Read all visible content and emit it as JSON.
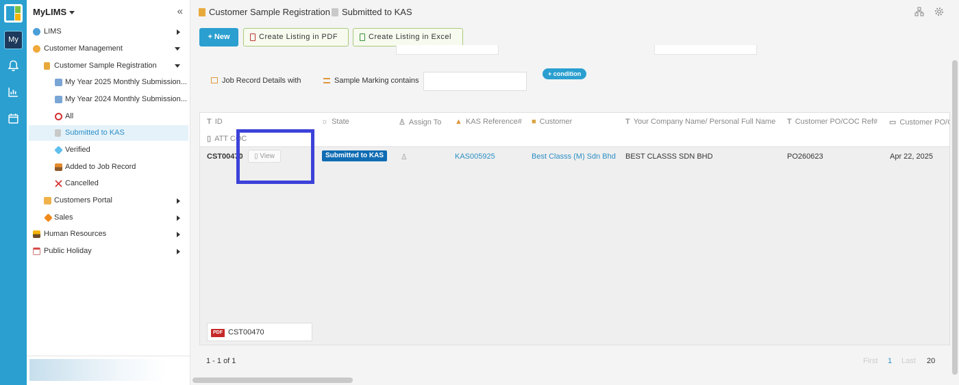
{
  "rail": {
    "my_label": "My"
  },
  "sidebar": {
    "title": "MyLIMS",
    "collapse_glyph": "«",
    "items": [
      {
        "label": "LIMS",
        "icon": "globe-icon"
      },
      {
        "label": "Customer Management",
        "icon": "smiley-icon"
      },
      {
        "label": "Customer Sample Registration",
        "icon": "scroll-icon"
      },
      {
        "label": "My Year 2025 Monthly Submission...",
        "icon": "chart-icon"
      },
      {
        "label": "My Year 2024 Monthly Submission...",
        "icon": "chart-icon"
      },
      {
        "label": "All",
        "icon": "circle-icon"
      },
      {
        "label": "Submitted to KAS",
        "icon": "document-icon"
      },
      {
        "label": "Verified",
        "icon": "diamond-icon"
      },
      {
        "label": "Added to Job Record",
        "icon": "inbox-icon"
      },
      {
        "label": "Cancelled",
        "icon": "cross-icon"
      },
      {
        "label": "Customers Portal",
        "icon": "portal-icon"
      },
      {
        "label": "Sales",
        "icon": "orange-diamond-icon"
      },
      {
        "label": "Human Resources",
        "icon": "landscape-icon"
      },
      {
        "label": "Public Holiday",
        "icon": "calendar-icon"
      }
    ]
  },
  "header": {
    "breadcrumb_1": "Customer Sample Registration",
    "breadcrumb_2": "Submitted to KAS"
  },
  "toolbar": {
    "new_label": "+ New",
    "pdf_label": "Create Listing in PDF",
    "excel_label": "Create Listing in Excel"
  },
  "filter": {
    "job_record": "Job Record Details  with",
    "sample_marking": "Sample Marking  contains",
    "condition_label": "+ condition"
  },
  "table": {
    "columns": [
      "ID",
      "State",
      "Assign To",
      "KAS Reference#",
      "Customer",
      "Your Company Name/ Personal Full Name",
      "Customer PO/COC Ref#",
      "Customer PO/C",
      "ATT COC"
    ],
    "rows": [
      {
        "id": "CST00470",
        "view": "View",
        "state": "Submitted to KAS",
        "kas_ref": "KAS005925",
        "customer": "Best Classs (M) Sdn Bhd",
        "company": "BEST CLASSS SDN BHD",
        "po_ref": "PO260623",
        "po_date": "Apr 22, 2025",
        "attachment": "CST00470",
        "attachment_type": "PDF"
      }
    ]
  },
  "pagination": {
    "count": "1 - 1 of 1",
    "first": "First",
    "page": "1",
    "last": "Last",
    "per_page": "20"
  },
  "colors": {
    "accent": "#2a9fd0",
    "state_badge": "#0f6cb3",
    "link": "#2a8fc5",
    "highlight": "#3c42d8"
  }
}
